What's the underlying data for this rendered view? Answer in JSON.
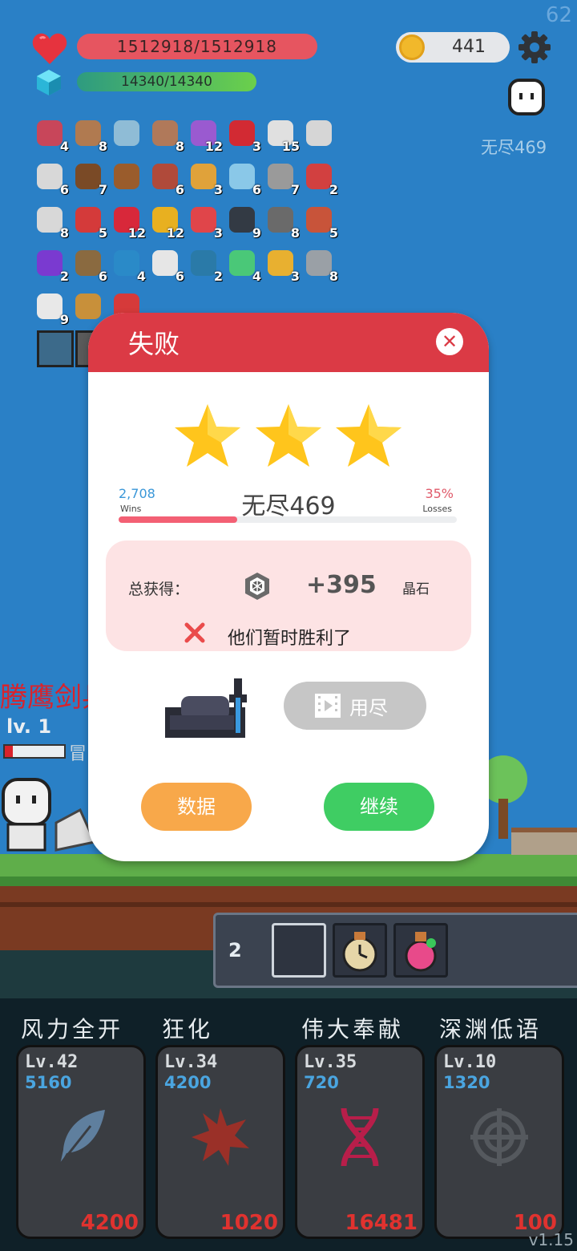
{
  "hud": {
    "fps": "62",
    "hp": "1512918/1512918",
    "mp": "14340/14340",
    "coins": "441",
    "mode": "无尽469"
  },
  "inventory": [
    {
      "icon": "jam-jar-icon",
      "count": "4",
      "color": "#c8465a"
    },
    {
      "icon": "wood-shield-icon",
      "count": "8",
      "color": "#b07a50"
    },
    {
      "icon": "magnifier-icon",
      "count": "",
      "color": "#8fbcd6"
    },
    {
      "icon": "sword-icon",
      "count": "8",
      "color": "#b0795a"
    },
    {
      "icon": "gift-box-icon",
      "count": "12",
      "color": "#9a5ad0"
    },
    {
      "icon": "apple-icon",
      "count": "3",
      "color": "#d22a33"
    },
    {
      "icon": "pill-icon",
      "count": "15",
      "color": "#e0e0e0"
    },
    {
      "icon": "gear-flower-icon",
      "count": "",
      "color": "#d6d6d6"
    },
    {
      "icon": "lightbulb-icon",
      "count": "6",
      "color": "#d8d8d8"
    },
    {
      "icon": "coconut-icon",
      "count": "7",
      "color": "#7a4a26"
    },
    {
      "icon": "treasure-chest-icon",
      "count": "",
      "color": "#9a5c2c"
    },
    {
      "icon": "door-icon",
      "count": "6",
      "color": "#b04a3a"
    },
    {
      "icon": "ring-icon",
      "count": "3",
      "color": "#e0a23a"
    },
    {
      "icon": "potion-icon",
      "count": "6",
      "color": "#8ac8e8"
    },
    {
      "icon": "spiked-mace-icon",
      "count": "7",
      "color": "#9a9a9a"
    },
    {
      "icon": "hook-icon",
      "count": "2",
      "color": "#d24040"
    },
    {
      "icon": "envelope-icon",
      "count": "8",
      "color": "#d8d8d8"
    },
    {
      "icon": "red-shield-icon",
      "count": "5",
      "color": "#d43a3a"
    },
    {
      "icon": "strawberry-icon",
      "count": "12",
      "color": "#d8283a"
    },
    {
      "icon": "sunflower-icon",
      "count": "12",
      "color": "#e8b020"
    },
    {
      "icon": "watermelon-icon",
      "count": "3",
      "color": "#e0454a"
    },
    {
      "icon": "cauldron-icon",
      "count": "9",
      "color": "#333a44"
    },
    {
      "icon": "meteor-icon",
      "count": "8",
      "color": "#6a6a6a"
    },
    {
      "icon": "flag-pot-icon",
      "count": "5",
      "color": "#c8543a"
    },
    {
      "icon": "crystal-ball-icon",
      "count": "2",
      "color": "#7a3ad0"
    },
    {
      "icon": "crossbow-icon",
      "count": "6",
      "color": "#8a6a40"
    },
    {
      "icon": "blue-gem-icon",
      "count": "4",
      "color": "#2a8ac8"
    },
    {
      "icon": "ghost-icon",
      "count": "6",
      "color": "#e6e6e6"
    },
    {
      "icon": "speech-bubble-icon",
      "count": "2",
      "color": "#2a7aa8"
    },
    {
      "icon": "green-spirit-icon",
      "count": "4",
      "color": "#4ac878"
    },
    {
      "icon": "magic-wand-icon",
      "count": "3",
      "color": "#e8b030"
    },
    {
      "icon": "battle-axe-icon",
      "count": "8",
      "color": "#9aa0a6"
    },
    {
      "icon": "dice-icon",
      "count": "9",
      "color": "#e8e8e8"
    },
    {
      "icon": "book-icon",
      "count": "",
      "color": "#c8903a"
    },
    {
      "icon": "heart-item-icon",
      "count": "",
      "color": "#d63a3a"
    }
  ],
  "side": {
    "name": "腾鹰剑兵",
    "level": "lv. 1",
    "status": "冒"
  },
  "modal": {
    "title": "失败",
    "wins_value": "2,708",
    "wins_label": "Wins",
    "losses_value": "35%",
    "losses_label": "Losses",
    "stage": "无尽469",
    "progress": 0.35,
    "total_label": "总获得：",
    "amount": "+395",
    "unit": "晶石",
    "message": "他们暂时胜利了",
    "video_button": "用尽",
    "data_button": "数据",
    "continue_button": "继续"
  },
  "quickbar": {
    "number": "2"
  },
  "skills": [
    {
      "name": "风力全开",
      "level": "Lv.42",
      "value": "5160",
      "cost": "4200",
      "icon": "feather-icon"
    },
    {
      "name": "狂化",
      "level": "Lv.34",
      "value": "4200",
      "cost": "1020",
      "icon": "burst-icon"
    },
    {
      "name": "伟大奉献",
      "level": "Lv.35",
      "value": "720",
      "cost": "16481",
      "icon": "dna-icon"
    },
    {
      "name": "深渊低语",
      "level": "Lv.10",
      "value": "1320",
      "cost": "100",
      "icon": "crosshair-icon"
    }
  ],
  "version": "v1.15",
  "colors": {
    "modal_header": "#db3a45",
    "continue": "#3fcd63",
    "data": "#f8a84a",
    "star": "#ffc51c"
  }
}
